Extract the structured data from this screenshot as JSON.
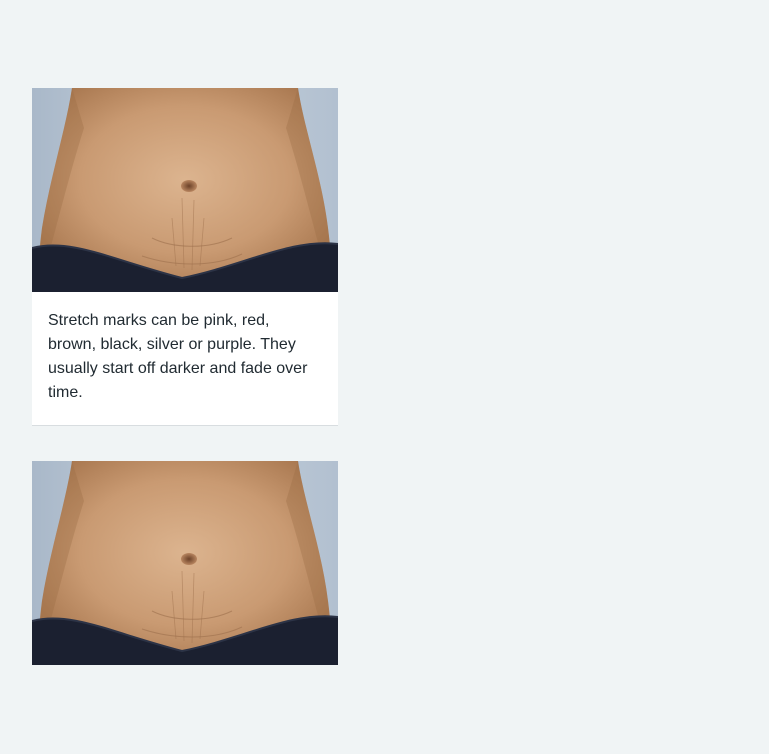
{
  "figures": [
    {
      "image_subject": "stretch-marks-on-abdomen",
      "caption": "Stretch marks can be pink, red, brown, black, silver or purple. They usually start off darker and fade over time."
    },
    {
      "image_subject": "stretch-marks-on-abdomen",
      "caption": ""
    }
  ],
  "colors": {
    "page_background": "#f0f4f5",
    "card_background": "#ffffff",
    "text": "#212b32",
    "border": "#d8dde0"
  }
}
